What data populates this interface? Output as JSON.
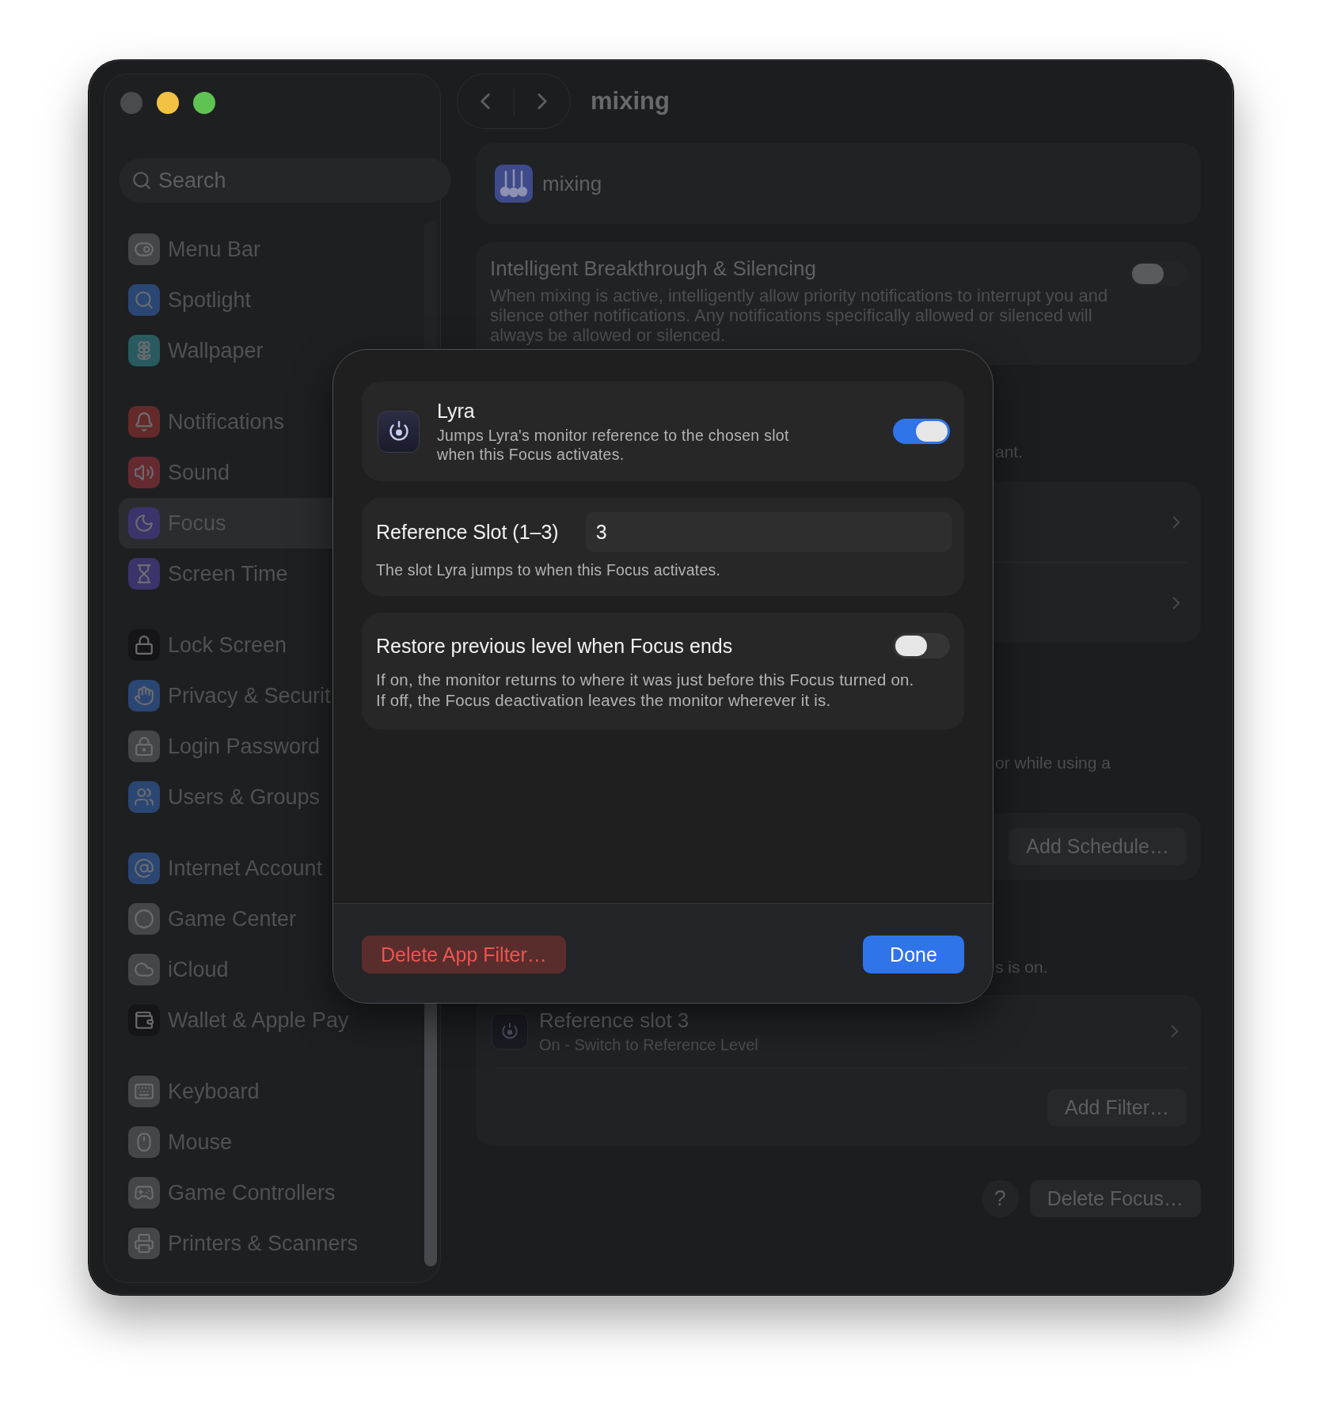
{
  "window": {
    "title": "mixing"
  },
  "sidebar": {
    "search": {
      "placeholder": "Search"
    },
    "groups": [
      {
        "items": [
          {
            "label": "Menu Bar",
            "color": "#454649",
            "selected": false
          },
          {
            "label": "Spotlight",
            "color": "#2a4673",
            "selected": false
          },
          {
            "label": "Wallpaper",
            "color": "#285a60",
            "selected": false
          }
        ]
      },
      {
        "items": [
          {
            "label": "Notifications",
            "color": "#642a2a",
            "selected": false
          },
          {
            "label": "Sound",
            "color": "#642a30",
            "selected": false
          },
          {
            "label": "Focus",
            "color": "#3b346b",
            "selected": true
          },
          {
            "label": "Screen Time",
            "color": "#3b346b",
            "selected": false
          }
        ]
      },
      {
        "items": [
          {
            "label": "Lock Screen",
            "color": "#151517",
            "selected": false
          },
          {
            "label": "Privacy & Securit",
            "color": "#2a4673",
            "selected": false
          },
          {
            "label": "Login Password",
            "color": "#454649",
            "selected": false
          },
          {
            "label": "Users & Groups",
            "color": "#2a4673",
            "selected": false
          }
        ]
      },
      {
        "items": [
          {
            "label": "Internet Account",
            "color": "#2a4673",
            "selected": false
          },
          {
            "label": "Game Center",
            "color": "#454649",
            "selected": false
          },
          {
            "label": "iCloud",
            "color": "#454649",
            "selected": false
          },
          {
            "label": "Wallet & Apple Pay",
            "color": "#151517",
            "selected": false
          }
        ]
      },
      {
        "items": [
          {
            "label": "Keyboard",
            "color": "#454649",
            "selected": false
          },
          {
            "label": "Mouse",
            "color": "#454649",
            "selected": false
          },
          {
            "label": "Game Controllers",
            "color": "#454649",
            "selected": false
          },
          {
            "label": "Printers & Scanners",
            "color": "#454649",
            "selected": false
          }
        ]
      }
    ]
  },
  "main": {
    "focus_name": "mixing",
    "breakthrough": {
      "title": "Intelligent Breakthrough & Silencing",
      "description": "When mixing is active, intelligently allow priority notifications to interrupt you and silence other notifications. Any notifications specifically allowed or silenced will always be allowed or silenced.",
      "on": false
    },
    "sections": [
      {
        "kind": "note",
        "text": "ant."
      },
      {
        "kind": "links"
      },
      {
        "kind": "note",
        "text": "or while using a"
      },
      {
        "kind": "button_card",
        "button": "Add Schedule…"
      },
      {
        "kind": "note",
        "text": "s is on."
      },
      {
        "kind": "filter_card",
        "filter": {
          "title": "Reference slot 3",
          "subtitle": "On - Switch to Reference Level"
        },
        "button": "Add Filter…"
      }
    ],
    "footer": {
      "help": "?",
      "delete": "Delete Focus…"
    }
  },
  "sheet": {
    "app": {
      "name": "Lyra",
      "description": "Jumps Lyra's monitor reference to the chosen slot when this Focus activates.",
      "on": true
    },
    "slot": {
      "label": "Reference Slot (1–3)",
      "value": "3",
      "hint": "The slot Lyra jumps to when this Focus activates."
    },
    "restore": {
      "label": "Restore previous level when Focus ends",
      "on": false,
      "description_lines": [
        "If on, the monitor returns to where it was just before this Focus turned on.",
        "If off, the Focus deactivation leaves the monitor wherever it is."
      ]
    },
    "buttons": {
      "delete": "Delete App Filter…",
      "done": "Done"
    }
  }
}
